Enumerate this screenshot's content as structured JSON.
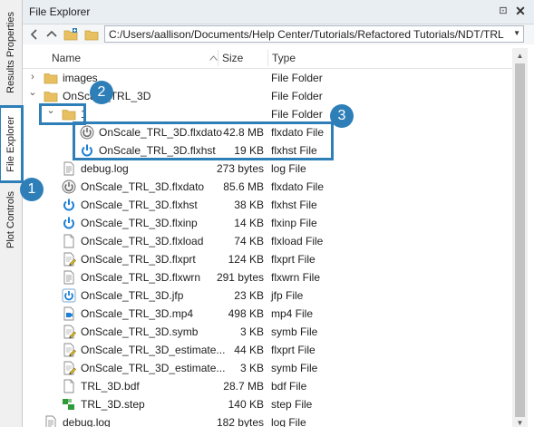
{
  "sidebar": {
    "tabs": [
      {
        "label": "Results Properties",
        "active": false
      },
      {
        "label": "File Explorer",
        "active": true
      },
      {
        "label": "Plot Controls",
        "active": false
      }
    ]
  },
  "panel": {
    "title": "File Explorer",
    "pin_glyph": "⊡",
    "close_glyph": "✕"
  },
  "toolbar": {
    "path": "C:/Users/aallison/Documents/Help Center/Tutorials/Refactored Tutorials/NDT/TRL"
  },
  "columns": {
    "name": "Name",
    "size": "Size",
    "type": "Type"
  },
  "rows": [
    {
      "name": "images",
      "size": "",
      "type": "File Folder",
      "icon": "folder-icon",
      "toggle": "›"
    },
    {
      "name": "OnScale_TRL_3D",
      "size": "",
      "type": "File Folder",
      "icon": "folder-icon",
      "toggle": "⌄"
    },
    {
      "name": "1",
      "size": "",
      "type": "File Folder",
      "icon": "folder-icon",
      "toggle": "⌄"
    },
    {
      "name": "OnScale_TRL_3D.flxdato",
      "size": "42.8 MB",
      "type": "flxdato File",
      "icon": "power-grey-icon"
    },
    {
      "name": "OnScale_TRL_3D.flxhst",
      "size": "19 KB",
      "type": "flxhst File",
      "icon": "power-blue-icon"
    },
    {
      "name": "debug.log",
      "size": "273 bytes",
      "type": "log File",
      "icon": "text-file-icon"
    },
    {
      "name": "OnScale_TRL_3D.flxdato",
      "size": "85.6 MB",
      "type": "flxdato File",
      "icon": "power-grey-icon"
    },
    {
      "name": "OnScale_TRL_3D.flxhst",
      "size": "38 KB",
      "type": "flxhst File",
      "icon": "power-blue-icon"
    },
    {
      "name": "OnScale_TRL_3D.flxinp",
      "size": "14 KB",
      "type": "flxinp File",
      "icon": "power-blue-icon"
    },
    {
      "name": "OnScale_TRL_3D.flxload",
      "size": "74 KB",
      "type": "flxload File",
      "icon": "blank-file-icon"
    },
    {
      "name": "OnScale_TRL_3D.flxprt",
      "size": "124 KB",
      "type": "flxprt File",
      "icon": "edit-file-icon"
    },
    {
      "name": "OnScale_TRL_3D.flxwrn",
      "size": "291 bytes",
      "type": "flxwrn File",
      "icon": "text-file-icon"
    },
    {
      "name": "OnScale_TRL_3D.jfp",
      "size": "23 KB",
      "type": "jfp File",
      "icon": "power-blue-framed-icon"
    },
    {
      "name": "OnScale_TRL_3D.mp4",
      "size": "498 KB",
      "type": "mp4 File",
      "icon": "video-file-icon"
    },
    {
      "name": "OnScale_TRL_3D.symb",
      "size": "3 KB",
      "type": "symb File",
      "icon": "edit-file-icon"
    },
    {
      "name": "OnScale_TRL_3D_estimate...",
      "size": "44 KB",
      "type": "flxprt File",
      "icon": "edit-file-icon"
    },
    {
      "name": "OnScale_TRL_3D_estimate...",
      "size": "3 KB",
      "type": "symb File",
      "icon": "edit-file-icon"
    },
    {
      "name": "TRL_3D.bdf",
      "size": "28.7 MB",
      "type": "bdf File",
      "icon": "blank-file-icon"
    },
    {
      "name": "TRL_3D.step",
      "size": "140 KB",
      "type": "step File",
      "icon": "step-file-icon"
    },
    {
      "name": "debug.log",
      "size": "182 bytes",
      "type": "log File",
      "icon": "text-file-icon"
    }
  ],
  "callouts": [
    {
      "label": "1"
    },
    {
      "label": "2"
    },
    {
      "label": "3"
    }
  ],
  "colors": {
    "accent": "#2e7fb8",
    "folder": "#e8c062",
    "power_blue": "#1a7fd4"
  }
}
